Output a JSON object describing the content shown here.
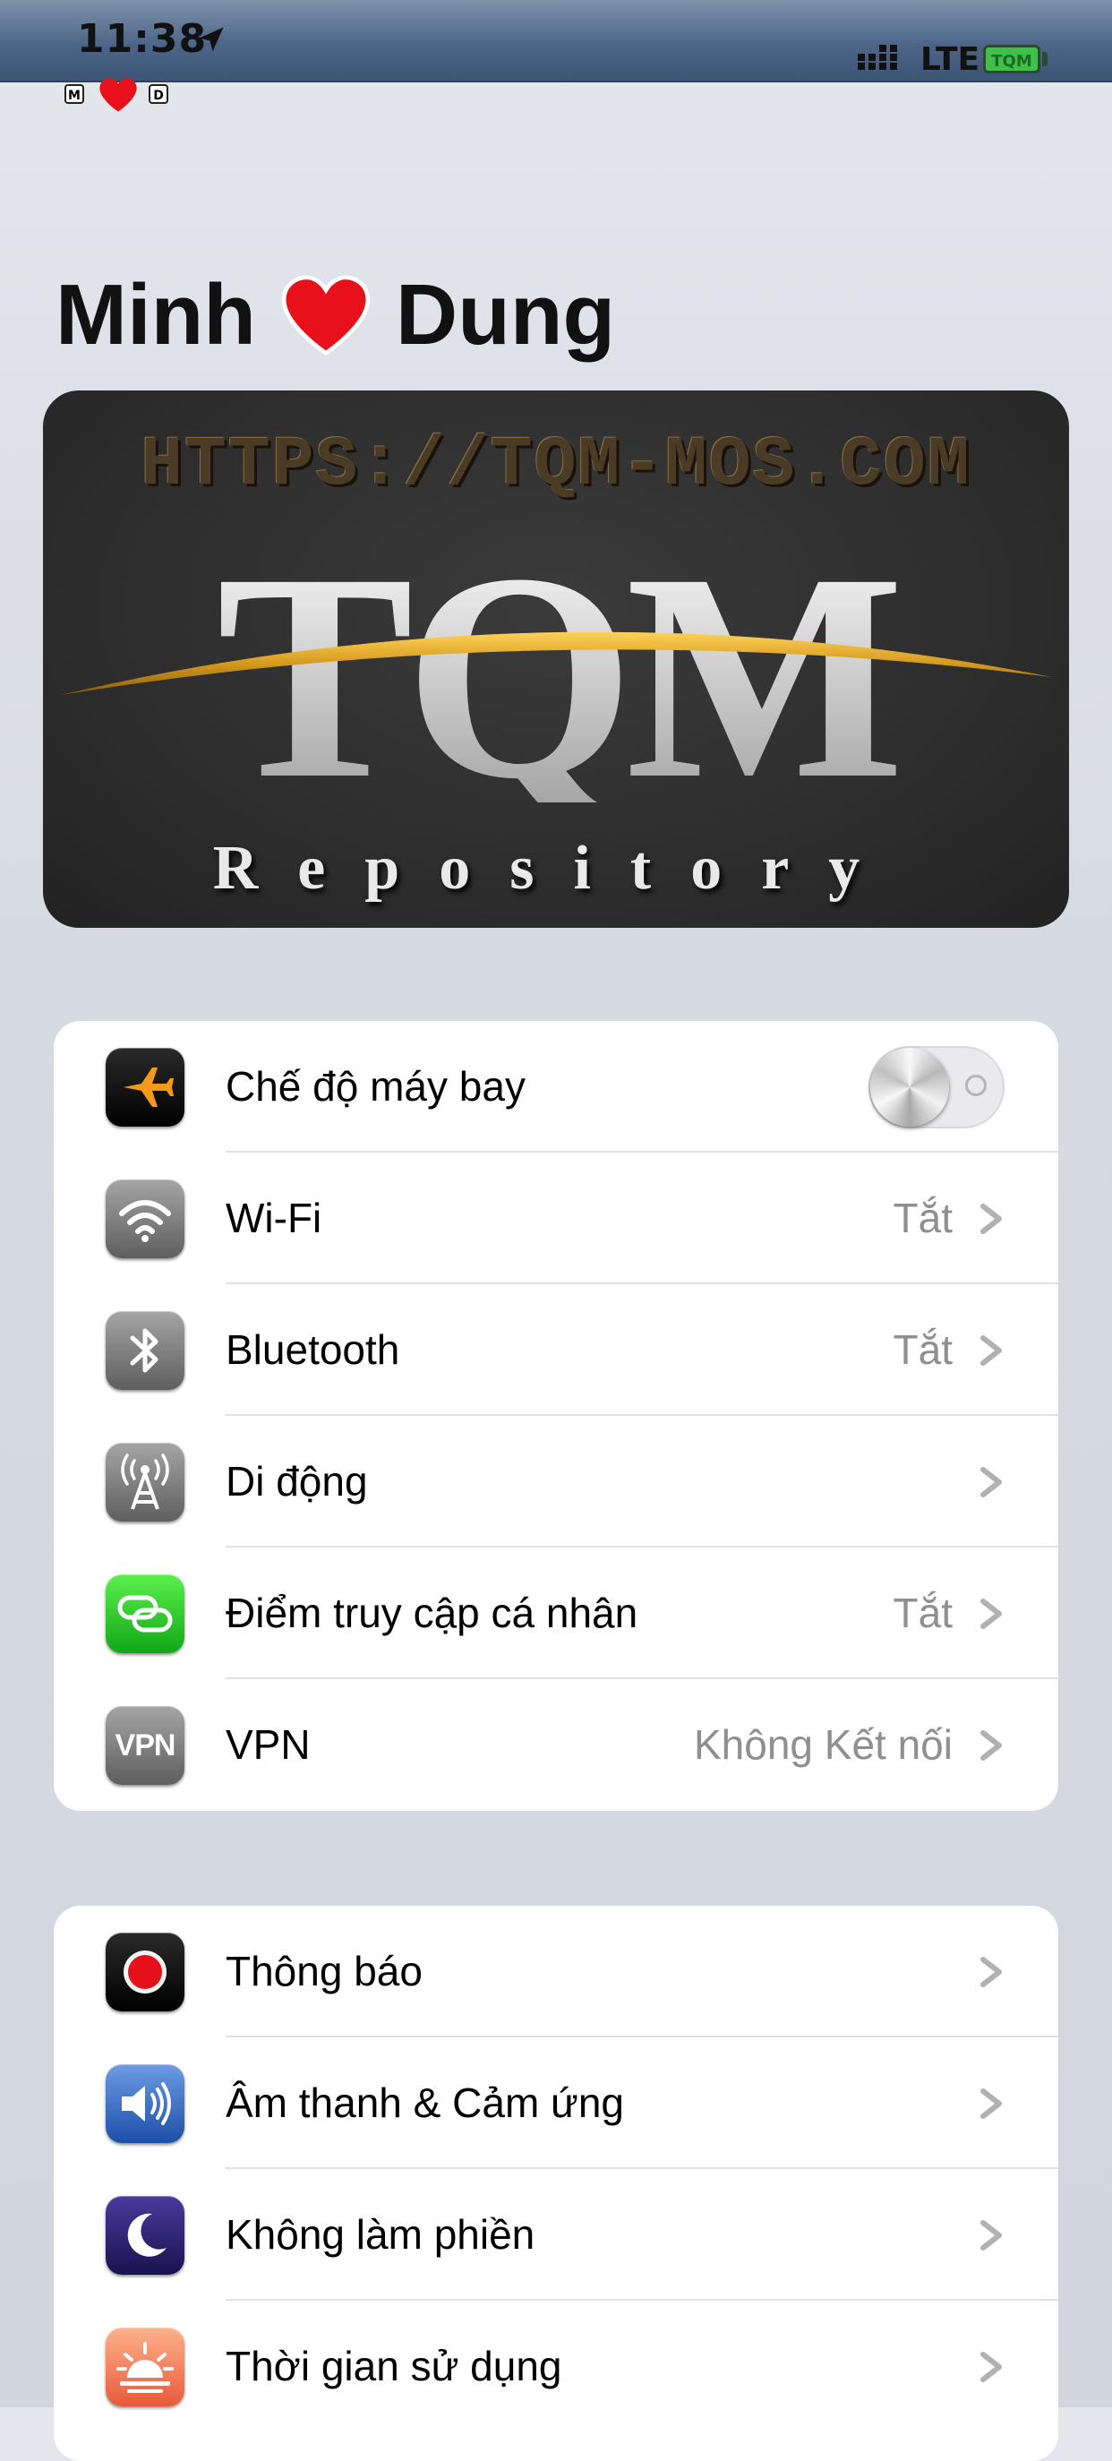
{
  "status_bar": {
    "time": "11:38",
    "network": "LTE",
    "battery_label": "TQM",
    "badge_left": "M",
    "badge_right": "D"
  },
  "header": {
    "name_left": "Minh",
    "name_right": "Dung"
  },
  "banner": {
    "url": "HTTPS://TQM-MOS.COM",
    "logo_text": "TQM",
    "subtitle": "Repository"
  },
  "group1": [
    {
      "label": "Chế độ máy bay",
      "value": "",
      "icon": "airplane-icon",
      "toggle": true
    },
    {
      "label": "Wi-Fi",
      "value": "Tắt",
      "icon": "wifi-icon"
    },
    {
      "label": "Bluetooth",
      "value": "Tắt",
      "icon": "bluetooth-icon"
    },
    {
      "label": "Di động",
      "value": "",
      "icon": "cellular-icon"
    },
    {
      "label": "Điểm truy cập cá nhân",
      "value": "Tắt",
      "icon": "hotspot-icon"
    },
    {
      "label": "VPN",
      "value": "Không Kết nối",
      "icon": "vpn-icon",
      "icon_text": "VPN"
    }
  ],
  "group2": [
    {
      "label": "Thông báo",
      "icon": "notifications-icon"
    },
    {
      "label": "Âm thanh & Cảm ứng",
      "icon": "sound-icon"
    },
    {
      "label": "Không làm phiền",
      "icon": "moon-icon"
    },
    {
      "label": "Thời gian sử dụng",
      "icon": "screen-time-icon"
    }
  ],
  "colors": {
    "accent_red": "#e8101a",
    "status_bar": "#4d6587",
    "secondary_text": "#8e8e93"
  }
}
